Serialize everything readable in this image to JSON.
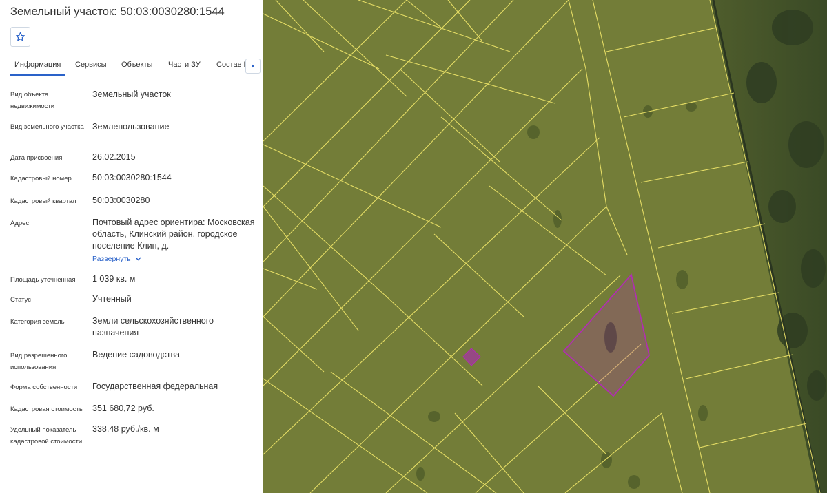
{
  "title": "Земельный участок: 50:03:0030280:1544",
  "favorite_icon": "star-icon",
  "tabs": [
    {
      "label": "Информация",
      "active": true
    },
    {
      "label": "Сервисы"
    },
    {
      "label": "Объекты"
    },
    {
      "label": "Части ЗУ"
    },
    {
      "label": "Состав Е"
    }
  ],
  "tab_scroll_icon": "chevron-right-icon",
  "info": [
    {
      "label": "Вид объекта недвижимости",
      "value": "Земельный участок"
    },
    {
      "label": "Вид земельного участка",
      "value": "Землепользование"
    },
    {
      "label": "Дата присвоения",
      "value": "26.02.2015"
    },
    {
      "label": "Кадастровый номер",
      "value": "50:03:0030280:1544"
    },
    {
      "label": "Кадастровый квартал",
      "value": "50:03:0030280"
    },
    {
      "label": "Адрес",
      "value": "Почтовый адрес ориентира: Московская область, Клинский район, городское поселение Клин, д."
    },
    {
      "label": "Площадь уточненная",
      "value": "1 039 кв. м"
    },
    {
      "label": "Статус",
      "value": "Учтенный"
    },
    {
      "label": "Категория земель",
      "value": "Земли сельскохозяйственного назначения"
    },
    {
      "label": "Вид разрешенного использования",
      "value": "Ведение садоводства"
    },
    {
      "label": "Форма собственности",
      "value": "Государственная федеральная"
    },
    {
      "label": "Кадастровая стоимость",
      "value": "351 680,72 руб."
    },
    {
      "label": "Удельный показатель кадастровой стоимости",
      "value": "338,48 руб./кв. м"
    }
  ],
  "expand_label": "Развернуть",
  "colors": {
    "accent": "#2a62c9",
    "parcel_boundary": "#f2e86a",
    "selected_parcel": "#b02fb0",
    "imagery": "#6f7a35"
  }
}
